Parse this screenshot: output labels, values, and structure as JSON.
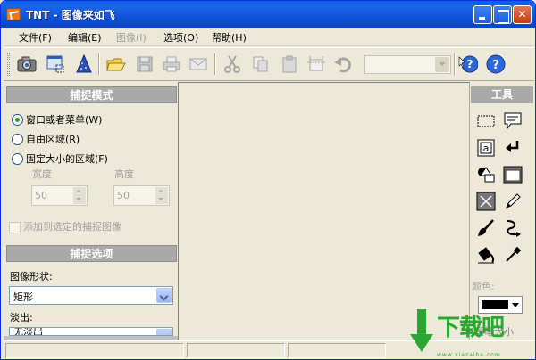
{
  "window": {
    "title": "TNT - 图像来如飞"
  },
  "menu": [
    "文件(F)",
    "编辑(E)",
    "图像(I)",
    "选项(O)",
    "帮助(H)"
  ],
  "menu_disabled": [
    false,
    false,
    true,
    false,
    false
  ],
  "toolbar": {
    "buttons": [
      "camera-icon",
      "screen-capture-icon",
      "wizard-icon",
      "open-folder-icon",
      "save-icon",
      "print-icon",
      "email-icon",
      "cut-icon",
      "copy-icon",
      "paste-icon",
      "crop-icon",
      "undo-icon",
      "help-icon",
      "info-icon"
    ]
  },
  "capture_mode": {
    "header": "捕捉模式",
    "options": [
      "窗口或者菜单(W)",
      "自由区域(R)",
      "固定大小的区域(F)"
    ],
    "selected": 0,
    "width_label": "宽度",
    "height_label": "高度",
    "width_value": "50",
    "height_value": "50",
    "add_to_selected": "添加到选定的捕捉图像"
  },
  "capture_options": {
    "header": "捕捉选项",
    "shape_label": "图像形状:",
    "shape_value": "矩形",
    "fade_label": "淡出:",
    "fade_value": "无淡出"
  },
  "tools": {
    "header": "工具",
    "items": [
      "rect-select-icon",
      "callout-icon",
      "text-icon",
      "arrow-icon",
      "shapes-icon",
      "frame-icon",
      "cross-icon",
      "pencil-icon",
      "brush-icon",
      "curve-icon",
      "fill-bucket-icon",
      "eyedropper-icon"
    ],
    "color_label": "颜色:",
    "color_value": "#000000",
    "size_label": "画笔大小"
  },
  "watermark": {
    "text": "下载吧",
    "url": "www.xiazaiba.com"
  }
}
